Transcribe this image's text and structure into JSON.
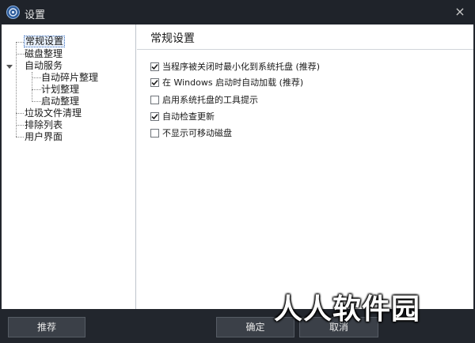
{
  "window": {
    "title": "设置",
    "close_label": "×"
  },
  "tree": {
    "items": [
      {
        "label": "常规设置",
        "selected": true
      },
      {
        "label": "磁盘整理"
      },
      {
        "label": "自动服务",
        "expanded": true
      },
      {
        "label": "自动碎片整理"
      },
      {
        "label": "计划整理"
      },
      {
        "label": "启动整理"
      },
      {
        "label": "垃圾文件清理"
      },
      {
        "label": "排除列表"
      },
      {
        "label": "用户界面"
      }
    ]
  },
  "panel": {
    "title": "常规设置",
    "options": [
      {
        "label": "当程序被关闭时最小化到系统托盘 (推荐)",
        "checked": true
      },
      {
        "label": "在 Windows 启动时自动加载 (推荐)",
        "checked": true
      },
      {
        "label": "启用系统托盘的工具提示",
        "checked": false
      },
      {
        "label": "自动检查更新",
        "checked": true
      },
      {
        "label": "不显示可移动磁盘",
        "checked": false
      }
    ]
  },
  "buttons": {
    "recommend": "推荐",
    "ok": "确定",
    "cancel": "取消"
  },
  "watermark": "人人软件园"
}
